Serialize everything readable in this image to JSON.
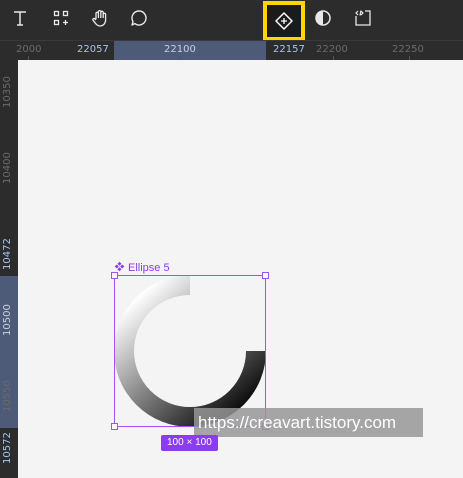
{
  "toolbar": {
    "tools": [
      {
        "name": "text-tool",
        "icon": "text-icon"
      },
      {
        "name": "components-tool",
        "icon": "components-icon"
      },
      {
        "name": "hand-tool",
        "icon": "hand-icon"
      },
      {
        "name": "comment-tool",
        "icon": "comment-icon"
      },
      {
        "name": "component-tool",
        "icon": "component-diamond-icon",
        "highlighted": true,
        "highlight_color": "#ffd500"
      },
      {
        "name": "mask-tool",
        "icon": "contrast-icon"
      },
      {
        "name": "dev-mode-tool",
        "icon": "code-icon"
      }
    ]
  },
  "ruler_top": {
    "labels": [
      "2000",
      "22057",
      "22100",
      "22157",
      "22200",
      "22250"
    ],
    "highlighted": [
      "22057",
      "22157"
    ]
  },
  "ruler_left": {
    "labels": [
      "10350",
      "10400",
      "10472",
      "10500",
      "10550",
      "10572"
    ],
    "highlighted": [
      "10472",
      "10572"
    ]
  },
  "selection": {
    "layer_name": "Ellipse 5",
    "layer_icon": "component-instance-icon",
    "size_label": "100 × 100",
    "accent_color": "#8b3cf0"
  },
  "ring": {
    "arc_fraction": 0.75,
    "gradient_from": "#ffffff",
    "gradient_to": "#000000"
  },
  "watermark": {
    "text": "https://creavart.tistory.com"
  },
  "colors": {
    "ui_dark": "#2c2c2c",
    "canvas": "#f4f4f4",
    "selection_range": "#4d5a78"
  }
}
